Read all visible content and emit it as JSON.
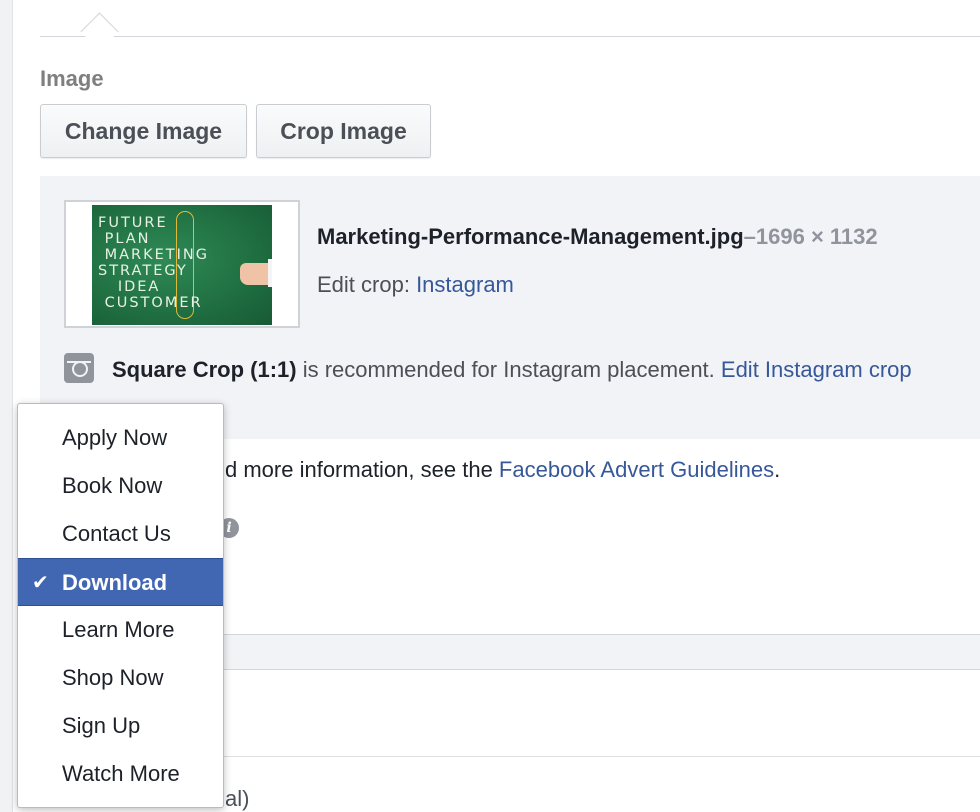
{
  "image_section": {
    "label": "Image",
    "change_image_button": "Change Image",
    "crop_image_button": "Crop Image"
  },
  "preview": {
    "thumbnail_text": "FUTURE\n PLAN\n MARKETING\nSTRATEGY\n   IDEA\n CUSTOMER",
    "file_name": "Marketing-Performance-Management.jpg",
    "separator": "–",
    "dimensions": "1696 × 1132",
    "edit_crop_label": "Edit crop:",
    "edit_crop_link": "Instagram",
    "instagram_note": {
      "bold": "Square Crop (1:1)",
      "text": " is recommended for Instagram placement. ",
      "link": "Edit Instagram crop"
    }
  },
  "guidelines": {
    "text_visible": "d more information, see the ",
    "link": "Facebook Advert Guidelines",
    "suffix": "."
  },
  "optional_label": "al)",
  "dropdown": {
    "selected": "Download",
    "options": [
      "Apply Now",
      "Book Now",
      "Contact Us",
      "Download",
      "Learn More",
      "Shop Now",
      "Sign Up",
      "Watch More"
    ]
  },
  "colors": {
    "link": "#365899",
    "selected_bg": "#4267b2",
    "panel_bg": "#f2f3f6"
  }
}
